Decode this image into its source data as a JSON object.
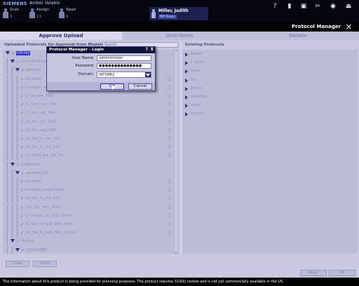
{
  "topbar": {
    "brand": "SIEMENS",
    "app_name": "Amber Volabis",
    "workflow": [
      {
        "label": "Scan",
        "count": "9"
      },
      {
        "label": "Assign",
        "count": "11"
      },
      {
        "label": "Read",
        "count": "9"
      }
    ],
    "patient": {
      "name": "Miller, Judith",
      "sub": "MP Basic"
    },
    "icons": [
      "help-icon",
      "status-icon",
      "monitor-icon",
      "scissors-icon",
      "eye-icon",
      "eject-icon"
    ]
  },
  "window": {
    "title": "Protocol Manager"
  },
  "tabs": [
    {
      "label": "Approve Upload",
      "active": true
    },
    {
      "label": "Distribute",
      "active": false
    },
    {
      "label": "Delete",
      "active": false
    }
  ],
  "left": {
    "header": "Uploaded Protocols for Approval from Modality:",
    "modality_value": "Search",
    "tree": [
      {
        "label": "nilcroy",
        "level": 0,
        "type": "folder",
        "selected": true
      },
      {
        "label": "clinical libraries",
        "level": 1,
        "type": "folder"
      },
      {
        "label": "general",
        "level": 2,
        "type": "folder"
      },
      {
        "label": "localizer",
        "level": 3,
        "type": "item"
      },
      {
        "label": "localizer_sag",
        "level": 3,
        "type": "item"
      },
      {
        "label": "t1_se_cor_256",
        "level": 3,
        "type": "item"
      },
      {
        "label": "t1_tirm_cor_256",
        "level": 3,
        "type": "item"
      },
      {
        "label": "t2_tse_sag_384",
        "level": 3,
        "type": "item"
      },
      {
        "label": "pd_tse_cor_384",
        "level": 3,
        "type": "item"
      },
      {
        "label": "pd_tse_sag_384",
        "level": 3,
        "type": "item"
      },
      {
        "label": "pd_tse_fs_cor_320",
        "level": 3,
        "type": "item"
      },
      {
        "label": "pd_tse_fs_tra_320",
        "level": 3,
        "type": "item"
      },
      {
        "label": "t2_de3d_we_sar_iso",
        "level": 3,
        "type": "item"
      },
      {
        "label": "programs",
        "level": 1,
        "type": "folder"
      },
      {
        "label": "general_2D",
        "level": 2,
        "type": "folder"
      },
      {
        "label": "localizer",
        "level": 3,
        "type": "item"
      },
      {
        "label": "localizer_sag/cor/tra",
        "level": 3,
        "type": "item"
      },
      {
        "label": "pd_tse_fs_tra_320",
        "level": 3,
        "type": "item"
      },
      {
        "label": "t2d_cor_384_2mm",
        "level": 3,
        "type": "item"
      },
      {
        "label": "t2_me2d_cor_320_2mm",
        "level": 3,
        "type": "item"
      },
      {
        "label": "t1_tse_cor_p2_384_2mm",
        "level": 3,
        "type": "item"
      },
      {
        "label": "pd_tse_fs_sag_384_2.5mm",
        "level": 3,
        "type": "item"
      },
      {
        "label": "library",
        "level": 1,
        "type": "folder"
      },
      {
        "label": "LOCALIZER",
        "level": 2,
        "type": "folder"
      }
    ],
    "buttons": {
      "load": "Load",
      "undo": "Undo"
    }
  },
  "right": {
    "header": "Existing Protocols",
    "items": [
      "breast",
      "c-spine",
      "head",
      "hip",
      "pelvis",
      "shoulder",
      "wrist",
      "thorax"
    ],
    "buttons": {
      "apply": "Apply",
      "ok": "OK"
    }
  },
  "dialog": {
    "title": "Protocol Manager - Login",
    "help": "?",
    "close": "X",
    "fields": {
      "username_label": "User Name",
      "username_value": "administrator",
      "password_label": "Password",
      "password_value": "●●●●●●●●●●●●●●",
      "domain_label": "Domain",
      "domain_value": "INTSMR2"
    },
    "ok_label": "OK",
    "cancel_label": "Cancel"
  },
  "footer": {
    "text": "The information about this product is being provided for planning purposes. The product requires 510(k) review and is not yet commercially available in the US."
  },
  "colors": {
    "accent": "#2c2fd0",
    "panel": "#c9c8e0",
    "titlebar": "#101236"
  }
}
